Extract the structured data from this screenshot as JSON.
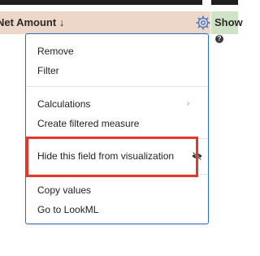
{
  "header": {
    "measure_label": "Net Amount",
    "sort_arrow": "↓",
    "gear_icon": "gear-icon",
    "show_label": "Show"
  },
  "help_icon": "?",
  "menu": {
    "items": [
      {
        "label": "Remove"
      },
      {
        "label": "Filter"
      },
      {
        "label": "Calculations",
        "submenu": true
      },
      {
        "label": "Create filtered measure"
      },
      {
        "label": "Hide this field from visualization",
        "icon": "eye-slash-icon"
      },
      {
        "label": "Copy values"
      },
      {
        "label": "Go to LookML"
      }
    ]
  },
  "colors": {
    "measure_header": "#ecd7c8",
    "show_header": "#cfe3c7",
    "menu_border": "#2f6fbf",
    "highlight_box": "#e5372a"
  }
}
